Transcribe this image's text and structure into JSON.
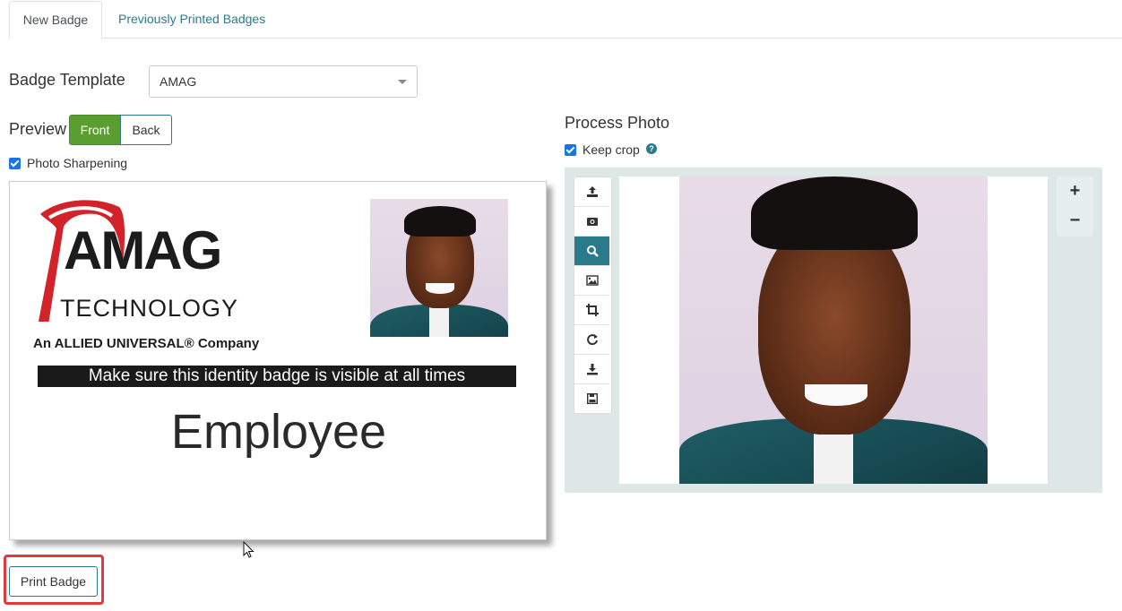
{
  "tabs": [
    {
      "label": "New Badge",
      "active": true
    },
    {
      "label": "Previously Printed Badges",
      "active": false
    }
  ],
  "template": {
    "label": "Badge Template",
    "value": "AMAG"
  },
  "preview": {
    "label": "Preview",
    "front_label": "Front",
    "back_label": "Back",
    "sharpening_label": "Photo Sharpening",
    "sharpening_checked": true
  },
  "badge": {
    "logo_main": "AMAG",
    "logo_sub": "TECHNOLOGY",
    "logo_company": "An ALLIED UNIVERSAL® Company",
    "notice": "Make sure this identity badge is visible at all times",
    "role": "Employee"
  },
  "process_photo": {
    "title": "Process Photo",
    "keep_crop_label": "Keep crop",
    "keep_crop_checked": true,
    "toolbar_icons": [
      "upload-icon",
      "camera-icon",
      "search-icon",
      "image-icon",
      "crop-icon",
      "rotate-icon",
      "download-icon",
      "save-icon"
    ],
    "active_tool": "search-icon",
    "zoom_in": "+",
    "zoom_out": "−"
  },
  "actions": {
    "print_label": "Print Badge"
  },
  "colors": {
    "primary": "#2a7a8c",
    "success": "#5a9e2f",
    "highlight": "#e03b3b",
    "logo_red": "#d3232a"
  }
}
